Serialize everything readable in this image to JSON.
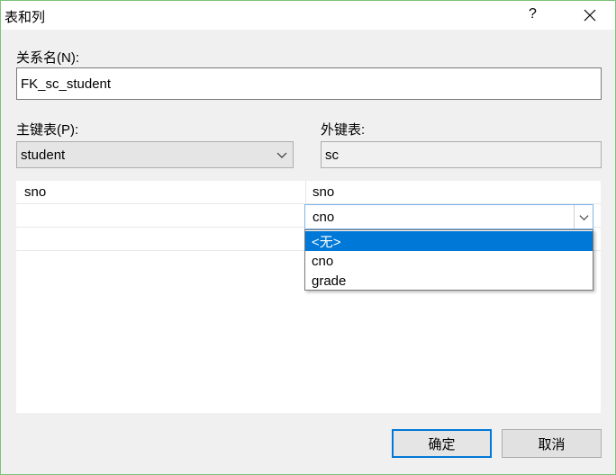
{
  "window": {
    "title": "表和列",
    "help_glyph": "?"
  },
  "relation_name": {
    "label": "关系名(N):",
    "value": "FK_sc_student"
  },
  "primary_table": {
    "label": "主键表(P):",
    "value": "student"
  },
  "foreign_table": {
    "label": "外键表:",
    "value": "sc"
  },
  "grid": {
    "rows": [
      {
        "pk": "sno",
        "fk": "sno"
      },
      {
        "pk": "",
        "fk": "cno"
      }
    ]
  },
  "dropdown": {
    "options": [
      "<无>",
      "cno",
      "grade"
    ],
    "selected_index": 0
  },
  "buttons": {
    "ok": "确定",
    "cancel": "取消"
  },
  "colors": {
    "accent": "#0078d7",
    "window_border": "#7ec27a"
  }
}
